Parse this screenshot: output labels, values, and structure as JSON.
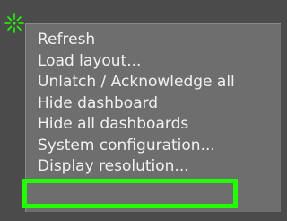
{
  "app_icon": "gear-sparkle-icon",
  "colors": {
    "background": "#4b4b4b",
    "menu_background": "#6e6e6e",
    "menu_text": "#f2f2f2",
    "highlight": "#22ff00",
    "icon": "#22ff00"
  },
  "menu": {
    "items": [
      {
        "label": "Refresh"
      },
      {
        "label": "Load layout..."
      },
      {
        "label": "Unlatch / Acknowledge all"
      },
      {
        "label": "Hide dashboard"
      },
      {
        "label": "Hide all dashboards"
      },
      {
        "label": "System configuration..."
      },
      {
        "label": "Display resolution...",
        "highlighted": true
      }
    ]
  }
}
